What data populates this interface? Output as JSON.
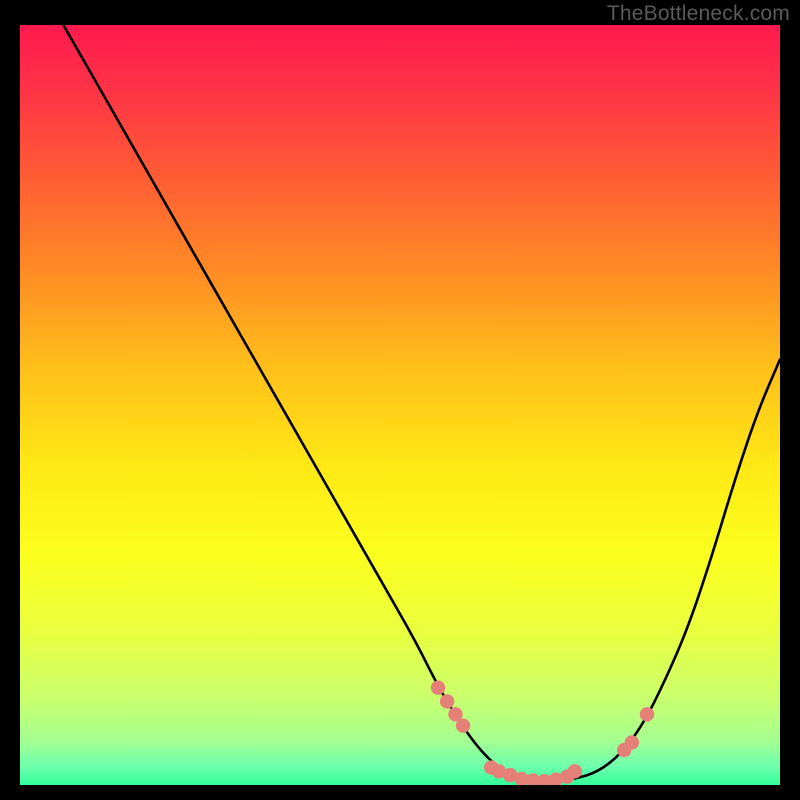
{
  "watermark": "TheBottleneck.com",
  "colors": {
    "background": "#000000",
    "gradient_stops": [
      {
        "offset": 0.0,
        "color": "#ff1a4d"
      },
      {
        "offset": 0.07,
        "color": "#ff2e49"
      },
      {
        "offset": 0.18,
        "color": "#ff5538"
      },
      {
        "offset": 0.32,
        "color": "#ff8a24"
      },
      {
        "offset": 0.45,
        "color": "#ffbf1a"
      },
      {
        "offset": 0.58,
        "color": "#ffe815"
      },
      {
        "offset": 0.7,
        "color": "#fbff1e"
      },
      {
        "offset": 0.8,
        "color": "#e9ff40"
      },
      {
        "offset": 0.88,
        "color": "#ccff6a"
      },
      {
        "offset": 0.94,
        "color": "#a6ff90"
      },
      {
        "offset": 0.975,
        "color": "#70ffae"
      },
      {
        "offset": 1.0,
        "color": "#33ff99"
      }
    ],
    "curve": "#000000",
    "marker": "#e58079"
  },
  "chart_data": {
    "type": "line",
    "title": "",
    "xlabel": "",
    "ylabel": "",
    "xlim": [
      0,
      100
    ],
    "ylim": [
      0,
      100
    ],
    "grid": false,
    "legend": false,
    "curve": {
      "x": [
        0,
        4,
        8,
        12,
        16,
        20,
        24,
        28,
        32,
        36,
        40,
        44,
        48,
        52,
        55,
        58,
        61,
        64,
        67,
        70,
        73,
        76,
        79,
        82,
        85,
        88,
        91,
        94,
        97,
        100
      ],
      "y": [
        110,
        103,
        96,
        89,
        82,
        75,
        68,
        61,
        54,
        47,
        40,
        33,
        26,
        19,
        13,
        8,
        4,
        1.5,
        0.6,
        0.5,
        0.8,
        1.7,
        4,
        8,
        14,
        21,
        30,
        40,
        49,
        56
      ]
    },
    "markers": {
      "x": [
        55.0,
        56.2,
        57.3,
        58.3,
        62.0,
        63.0,
        64.5,
        66.0,
        67.5,
        69.0,
        70.5,
        72.0,
        73.0,
        79.5,
        80.5,
        82.5
      ],
      "y": [
        12.8,
        11.0,
        9.3,
        7.8,
        2.3,
        1.8,
        1.3,
        0.8,
        0.6,
        0.5,
        0.7,
        1.1,
        1.8,
        4.6,
        5.6,
        9.3
      ]
    }
  }
}
